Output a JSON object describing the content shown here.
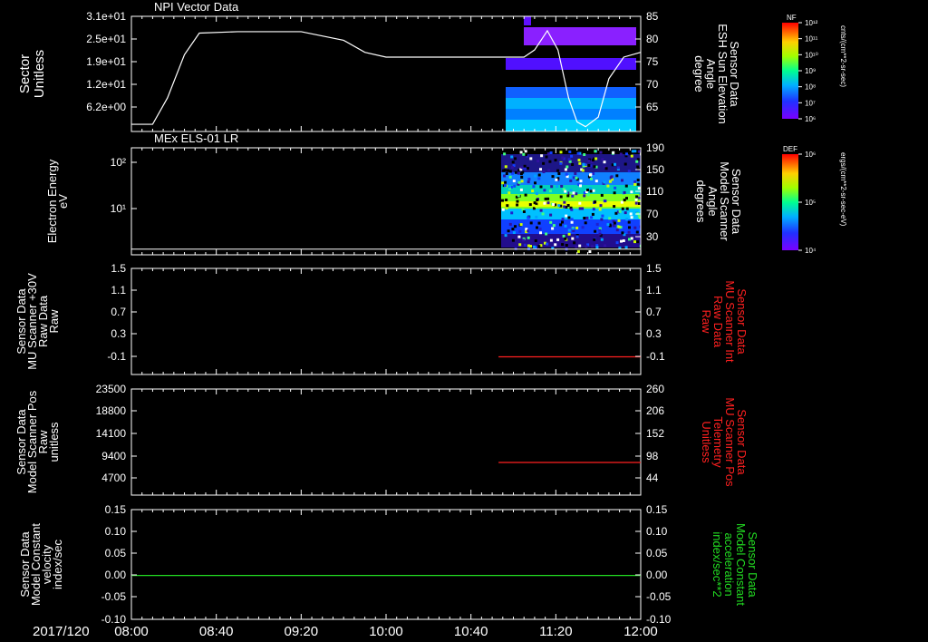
{
  "colors": {
    "background": "#000000",
    "axes": "#ffffff",
    "red_series": "#ff2020",
    "green_series": "#22dd22",
    "white_series": "#ffffff"
  },
  "time_axis": {
    "date_label": "2017/120",
    "ticks": [
      "08:00",
      "08:40",
      "09:20",
      "10:00",
      "10:40",
      "11:20",
      "12:00"
    ],
    "start_minutes": 480,
    "end_minutes": 720
  },
  "chart_data": [
    {
      "type": "heatmap",
      "title": "NPI Vector Data",
      "ylabel_left": [
        "Sector",
        "Unitless"
      ],
      "yticks_left": [
        "3.1e+01",
        "2.5e+01",
        "1.9e+01",
        "1.2e+01",
        "6.2e+00"
      ],
      "ylabel_right": [
        "Sensor Data",
        "ESH Sun Elevation",
        "Angle",
        "degree"
      ],
      "yticks_right": [
        "85",
        "80",
        "75",
        "70",
        "65"
      ],
      "ylim_right": [
        61,
        85
      ],
      "colorbar": {
        "label": "NF",
        "units": "cnts/(cm**2-sr-sec)",
        "ticks": [
          "10¹²",
          "10¹¹",
          "10¹⁰",
          "10⁹",
          "10⁸",
          "10⁷",
          "10⁶"
        ]
      },
      "line_series": {
        "name": "ESH Sun Elevation Angle",
        "x": [
          480,
          490,
          497,
          505,
          512,
          530,
          560,
          580,
          590,
          600,
          630,
          665,
          670,
          676,
          681,
          686,
          690,
          694,
          700,
          705,
          712,
          720
        ],
        "y": [
          62.5,
          62.5,
          68,
          77,
          81.5,
          81.8,
          81.8,
          80,
          77.5,
          76.5,
          76.5,
          76.5,
          78,
          82,
          78,
          68,
          63,
          62,
          64,
          72,
          76.5,
          77.5
        ]
      }
    },
    {
      "type": "heatmap",
      "title": "MEx ELS-01 LR",
      "ylabel_left": [
        "Electron Energy",
        "eV"
      ],
      "yticks_left": [
        "10²",
        "10¹"
      ],
      "ylabel_right": [
        "Sensor Data",
        "Model Scanner",
        "Angle",
        "degrees"
      ],
      "yticks_right": [
        "190",
        "150",
        "110",
        "70",
        "30"
      ],
      "ylim_right": [
        0,
        190
      ],
      "colorbar": {
        "label": "DEF",
        "units": "ergs/(cm**2-sr-sec-eV)",
        "ticks": [
          "10⁶",
          "10⁵",
          "10⁴"
        ]
      },
      "line_series": {
        "name": "Model Scanner Angle",
        "x": [
          480,
          720
        ],
        "y": [
          2,
          2
        ]
      }
    },
    {
      "type": "line",
      "ylabel_left": [
        "Sensor Data",
        "MU Scanner +30V",
        "Raw Data",
        "Raw"
      ],
      "yticks_left": [
        "1.5",
        "1.1",
        "0.7",
        "0.3",
        "-0.1"
      ],
      "ylim_left": [
        -0.3,
        1.5
      ],
      "ylabel_right": [
        "Sensor Data",
        "MU Scanner Int",
        "Raw Data",
        "Raw"
      ],
      "yticks_right": [
        "1.5",
        "1.1",
        "0.7",
        "0.3",
        "-0.1"
      ],
      "ylim_right": [
        -0.3,
        1.5
      ],
      "series": [
        {
          "x": [
            653,
            720
          ],
          "y": [
            0.0,
            0.0
          ]
        }
      ]
    },
    {
      "type": "line",
      "ylabel_left": [
        "Sensor Data",
        "Model Scanner Pos",
        "Raw",
        "unitless"
      ],
      "yticks_left": [
        "23500",
        "18800",
        "14100",
        "9400",
        "4700"
      ],
      "ylim_left": [
        0,
        23500
      ],
      "ylabel_right": [
        "Sensor Data",
        "MU Scanner Pos",
        "Telemetry",
        "Unitless"
      ],
      "yticks_right": [
        "260",
        "206",
        "152",
        "98",
        "44"
      ],
      "ylim_right": [
        0,
        260
      ],
      "series": [
        {
          "x": [
            653,
            720
          ],
          "y": [
            80,
            80
          ]
        }
      ]
    },
    {
      "type": "line",
      "ylabel_left": [
        "Sensor Data",
        "Model Constant",
        "velocity",
        "index/sec"
      ],
      "yticks_left": [
        "0.15",
        "0.10",
        "0.05",
        "0.00",
        "-0.05",
        "-0.10"
      ],
      "ylim_left": [
        -0.1,
        0.15
      ],
      "ylabel_right": [
        "Sensor Data",
        "Model Constant",
        "acceleration",
        "index/sec**2"
      ],
      "yticks_right": [
        "0.15",
        "0.10",
        "0.05",
        "0.00",
        "-0.05",
        "-0.10"
      ],
      "ylim_right": [
        -0.1,
        0.15
      ],
      "series": [
        {
          "x": [
            480,
            720
          ],
          "y": [
            0.0,
            0.0
          ]
        }
      ]
    }
  ]
}
